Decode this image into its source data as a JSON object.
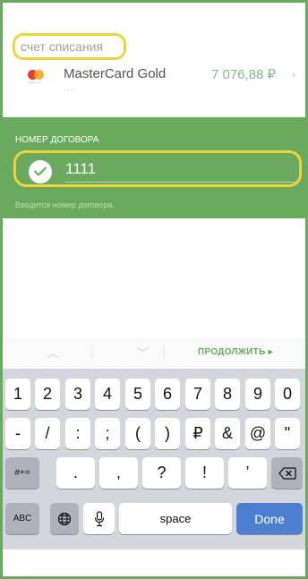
{
  "account": {
    "title": "счет списания",
    "card_name": "MasterCard Gold",
    "card_number_masked": "····",
    "card_caption": "mastercard",
    "balance": "7 076,88 ₽"
  },
  "contract": {
    "label": "НОМЕР ДОГОВОРА",
    "value": "1111",
    "hint": "Вводится номер договора."
  },
  "toolbar": {
    "prev_icon": "chevron-up-icon",
    "next_icon": "chevron-down-icon",
    "continue_label": "ПРОДОЛЖИТЬ ▸"
  },
  "keyboard": {
    "row1": [
      "1",
      "2",
      "3",
      "4",
      "5",
      "6",
      "7",
      "8",
      "9",
      "0"
    ],
    "row2": [
      "-",
      "/",
      ":",
      ";",
      "(",
      ")",
      "₽",
      "&",
      "@",
      "\""
    ],
    "row3_mode": "#+=",
    "row3": [
      ".",
      ",",
      "?",
      "!",
      "’"
    ],
    "abc": "ABC",
    "space": "space",
    "done": "Done"
  },
  "colors": {
    "accent": "#6aaa5e",
    "highlight": "#f2d23c",
    "done_button": "#4d7fd1"
  }
}
